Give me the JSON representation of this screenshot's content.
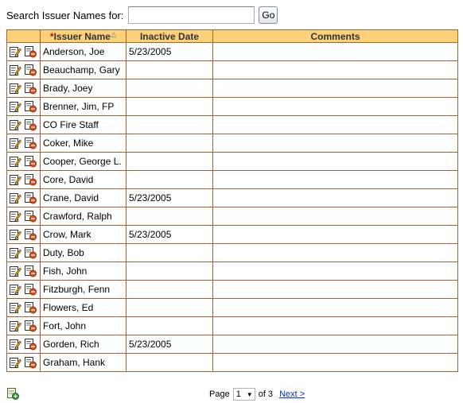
{
  "search": {
    "label": "Search Issuer Names for:",
    "value": "",
    "placeholder": "",
    "go_label": "Go"
  },
  "table": {
    "columns": {
      "required_marker": "*",
      "issuer_name": "Issuer Name",
      "inactive_date": "Inactive Date",
      "comments": "Comments"
    },
    "rows": [
      {
        "name": "Anderson, Joe",
        "inactive_date": "5/23/2005",
        "comments": ""
      },
      {
        "name": "Beauchamp, Gary",
        "inactive_date": "",
        "comments": ""
      },
      {
        "name": "Brady, Joey",
        "inactive_date": "",
        "comments": ""
      },
      {
        "name": "Brenner, Jim, FP",
        "inactive_date": "",
        "comments": ""
      },
      {
        "name": "CO Fire Staff",
        "inactive_date": "",
        "comments": ""
      },
      {
        "name": "Coker, Mike",
        "inactive_date": "",
        "comments": ""
      },
      {
        "name": "Cooper, George L.",
        "inactive_date": "",
        "comments": ""
      },
      {
        "name": "Core, David",
        "inactive_date": "",
        "comments": ""
      },
      {
        "name": "Crane, David",
        "inactive_date": "5/23/2005",
        "comments": ""
      },
      {
        "name": "Crawford, Ralph",
        "inactive_date": "",
        "comments": ""
      },
      {
        "name": "Crow, Mark",
        "inactive_date": "5/23/2005",
        "comments": ""
      },
      {
        "name": "Duty, Bob",
        "inactive_date": "",
        "comments": ""
      },
      {
        "name": "Fish, John",
        "inactive_date": "",
        "comments": ""
      },
      {
        "name": "Fitzburgh, Fenn",
        "inactive_date": "",
        "comments": ""
      },
      {
        "name": "Flowers, Ed",
        "inactive_date": "",
        "comments": ""
      },
      {
        "name": "Fort, John",
        "inactive_date": "",
        "comments": ""
      },
      {
        "name": "Gorden, Rich",
        "inactive_date": "5/23/2005",
        "comments": ""
      },
      {
        "name": "Graham, Hank",
        "inactive_date": "",
        "comments": ""
      }
    ]
  },
  "pager": {
    "page_label": "Page",
    "current_page": "1",
    "of_label": "of 3",
    "next_label": "Next >"
  },
  "icons": {
    "edit": "edit-icon",
    "delete": "delete-icon",
    "add": "add-row-icon"
  },
  "colors": {
    "header_bg": "#fbd27a",
    "border": "#9f6237",
    "link": "#0033cc"
  }
}
